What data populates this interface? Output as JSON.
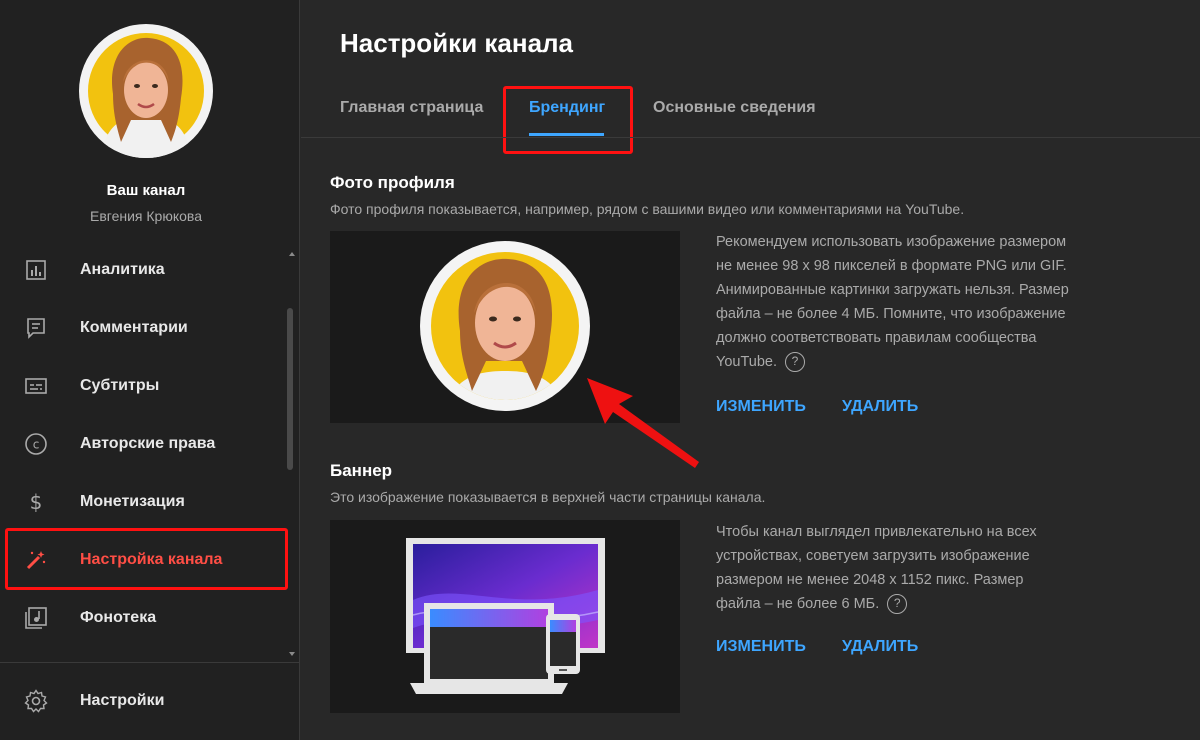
{
  "sidebar": {
    "channel_title": "Ваш канал",
    "channel_owner": "Евгения Крюкова",
    "items": [
      {
        "label": "Аналитика",
        "icon": "analytics-icon"
      },
      {
        "label": "Комментарии",
        "icon": "comments-icon"
      },
      {
        "label": "Субтитры",
        "icon": "subtitles-icon"
      },
      {
        "label": "Авторские права",
        "icon": "copyright-icon"
      },
      {
        "label": "Монетизация",
        "icon": "monetization-icon"
      },
      {
        "label": "Настройка канала",
        "icon": "customization-icon",
        "active": true
      },
      {
        "label": "Фонотека",
        "icon": "audio-library-icon"
      }
    ],
    "settings_label": "Настройки"
  },
  "main": {
    "title": "Настройки канала",
    "tabs": [
      {
        "label": "Главная страница"
      },
      {
        "label": "Брендинг",
        "active": true
      },
      {
        "label": "Основные сведения"
      }
    ],
    "profile_photo": {
      "title": "Фото профиля",
      "description": "Фото профиля показывается, например, рядом с вашими видео или комментариями на YouTube.",
      "info_lines": [
        "Рекомендуем использовать изображение размером",
        "не менее 98 x 98 пикселей в формате PNG или GIF.",
        "Анимированные картинки загружать нельзя. Размер",
        "файла – не более 4 МБ. Помните, что изображение",
        "должно соответствовать правилам сообщества",
        "YouTube."
      ],
      "change_label": "ИЗМЕНИТЬ",
      "delete_label": "УДАЛИТЬ"
    },
    "banner": {
      "title": "Баннер",
      "description": "Это изображение показывается в верхней части страницы канала.",
      "info_lines": [
        "Чтобы канал выглядел привлекательно на всех",
        "устройствах, советуем загрузить изображение",
        "размером не менее 2048 x 1152 пикс. Размер",
        "файла – не более 6 МБ."
      ],
      "change_label": "ИЗМЕНИТЬ",
      "delete_label": "УДАЛИТЬ"
    },
    "help_glyph": "?"
  },
  "colors": {
    "accent": "#3ea6ff",
    "active_nav": "#ff4e45",
    "annotation_red": "#ff1111",
    "background": "#282828",
    "sidebar_bg": "#212121"
  }
}
